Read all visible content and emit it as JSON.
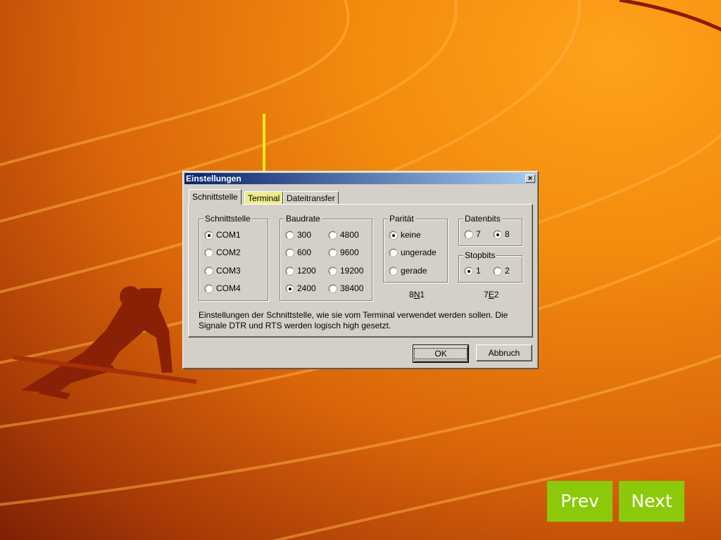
{
  "dialog": {
    "title": "Einstellungen",
    "close_symbol": "×",
    "tabs": [
      {
        "label": "Schnittstelle",
        "active": true
      },
      {
        "label": "Terminal",
        "active": false,
        "highlighted": true
      },
      {
        "label": "Dateitransfer",
        "active": false
      }
    ],
    "groups": {
      "schnittstelle": {
        "title": "Schnittstelle",
        "options": [
          "COM1",
          "COM2",
          "COM3",
          "COM4"
        ],
        "selected": "COM1"
      },
      "baudrate": {
        "title": "Baudrate",
        "options": [
          "300",
          "600",
          "1200",
          "2400",
          "4800",
          "9600",
          "19200",
          "38400"
        ],
        "selected": "2400"
      },
      "paritaet": {
        "title": "Parität",
        "options": [
          "keine",
          "ungerade",
          "gerade"
        ],
        "selected": "keine",
        "summary_pre": "8",
        "summary_u": "N",
        "summary_post": "1"
      },
      "datenbits": {
        "title": "Datenbits",
        "options": [
          "7",
          "8"
        ],
        "selected": "8"
      },
      "stopbits": {
        "title": "Stopbits",
        "options": [
          "1",
          "2"
        ],
        "selected": "1",
        "summary_pre": "7",
        "summary_u": "E",
        "summary_post": "2"
      }
    },
    "description": "Einstellungen der Schnittstelle, wie sie vom Terminal verwendet werden sollen. Die Signale DTR und RTS werden logisch high gesetzt.",
    "ok_label": "OK",
    "cancel_label": "Abbruch"
  },
  "nav": {
    "prev_label": "Prev",
    "next_label": "Next"
  },
  "colors": {
    "accent_arrow": "#f2ea1a",
    "nav_button": "#8cc90a",
    "titlebar": "#0a246a"
  },
  "icons": {
    "arrow": "down-arrow-icon",
    "runner": "sprinter-silhouette-icon"
  }
}
